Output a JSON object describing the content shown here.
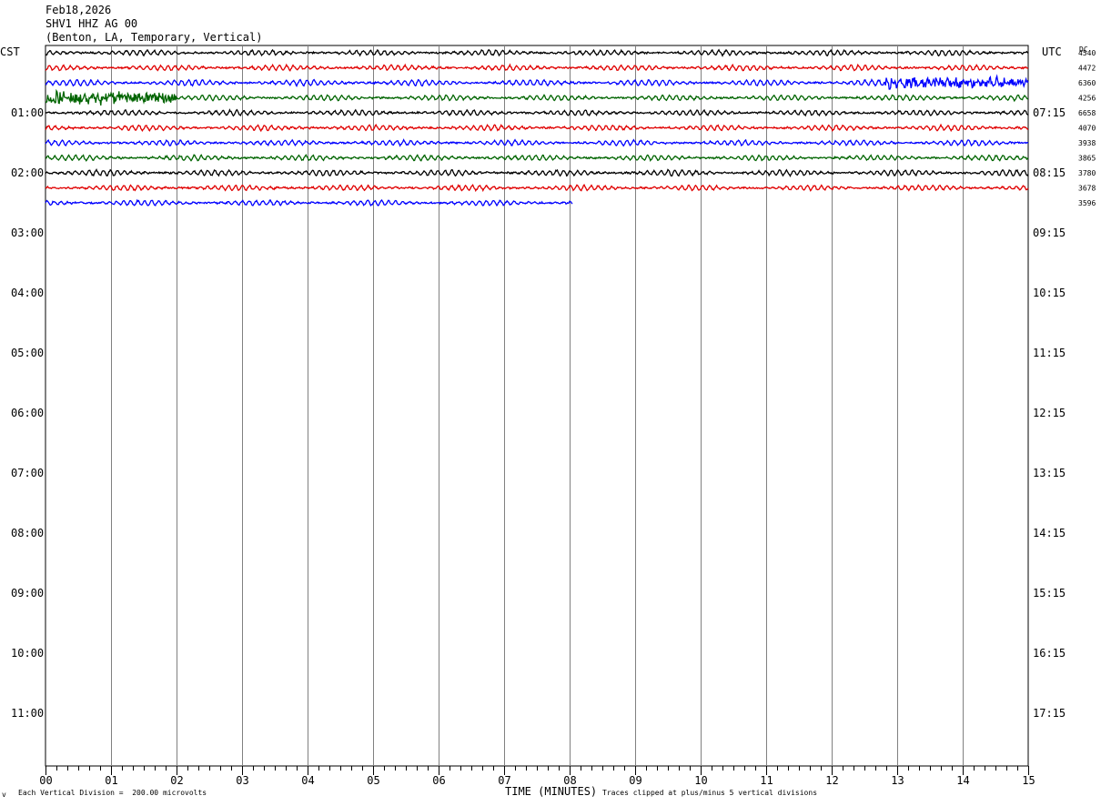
{
  "header": {
    "date": "Feb18,2026",
    "station": "SHV1 HHZ AG 00",
    "location": "(Benton, LA, Temporary, Vertical)"
  },
  "left_timezone": "CST",
  "right_timezone": "UTC",
  "dc_label": "DC",
  "footer": {
    "scale_note": "Each Vertical Division =  200.00 microvolts",
    "clip_note": "Traces clipped at plus/minus 5 vertical divisions",
    "corner_mark": "v"
  },
  "colors": {
    "trace_cycle": [
      "#000000",
      "#e00000",
      "#0000ff",
      "#006400"
    ],
    "grid": "#808080"
  },
  "chart_data": {
    "type": "line",
    "title": "Feb18,2026",
    "xlabel": "TIME (MINUTES)",
    "ylabel": "",
    "x_ticks": [
      "00",
      "01",
      "02",
      "03",
      "04",
      "05",
      "06",
      "07",
      "08",
      "09",
      "10",
      "11",
      "12",
      "13",
      "14",
      "15"
    ],
    "xlim": [
      0,
      15
    ],
    "rows_per_hour": 4,
    "total_rows": 48,
    "left_hour_labels": [
      "01:00",
      "02:00",
      "03:00",
      "04:00",
      "05:00",
      "06:00",
      "07:00",
      "08:00",
      "09:00",
      "10:00",
      "11:00"
    ],
    "right_hour_labels": [
      "07:15",
      "08:15",
      "09:15",
      "10:15",
      "11:15",
      "12:15",
      "13:15",
      "14:15",
      "15:15",
      "16:15",
      "17:15"
    ],
    "traces": [
      {
        "row": 0,
        "color": "#000000",
        "end_minute": 15,
        "amplitude": 1.0,
        "dc": "4540"
      },
      {
        "row": 1,
        "color": "#e00000",
        "end_minute": 15,
        "amplitude": 1.0,
        "dc": "4472"
      },
      {
        "row": 2,
        "color": "#0000ff",
        "end_minute": 15,
        "amplitude": 1.1,
        "dc": "6360"
      },
      {
        "row": 3,
        "color": "#006400",
        "end_minute": 15,
        "amplitude": 1.0,
        "dc": "4256"
      },
      {
        "row": 4,
        "color": "#000000",
        "end_minute": 15,
        "amplitude": 1.0,
        "dc": "6658"
      },
      {
        "row": 5,
        "color": "#e00000",
        "end_minute": 15,
        "amplitude": 1.0,
        "dc": "4070"
      },
      {
        "row": 6,
        "color": "#0000ff",
        "end_minute": 15,
        "amplitude": 1.0,
        "dc": "3938"
      },
      {
        "row": 7,
        "color": "#006400",
        "end_minute": 15,
        "amplitude": 1.0,
        "dc": "3865"
      },
      {
        "row": 8,
        "color": "#000000",
        "end_minute": 15,
        "amplitude": 1.1,
        "dc": "3780"
      },
      {
        "row": 9,
        "color": "#e00000",
        "end_minute": 15,
        "amplitude": 1.0,
        "dc": "3678"
      },
      {
        "row": 10,
        "color": "#0000ff",
        "end_minute": 8.05,
        "amplitude": 1.0,
        "dc": "3596"
      }
    ],
    "bursts": [
      {
        "row": 3,
        "from_minute": 0,
        "to_minute": 2.0,
        "amplitude": 3.2
      },
      {
        "row": 2,
        "from_minute": 12.8,
        "to_minute": 15.0,
        "amplitude": 2.6
      }
    ],
    "grid": true
  }
}
